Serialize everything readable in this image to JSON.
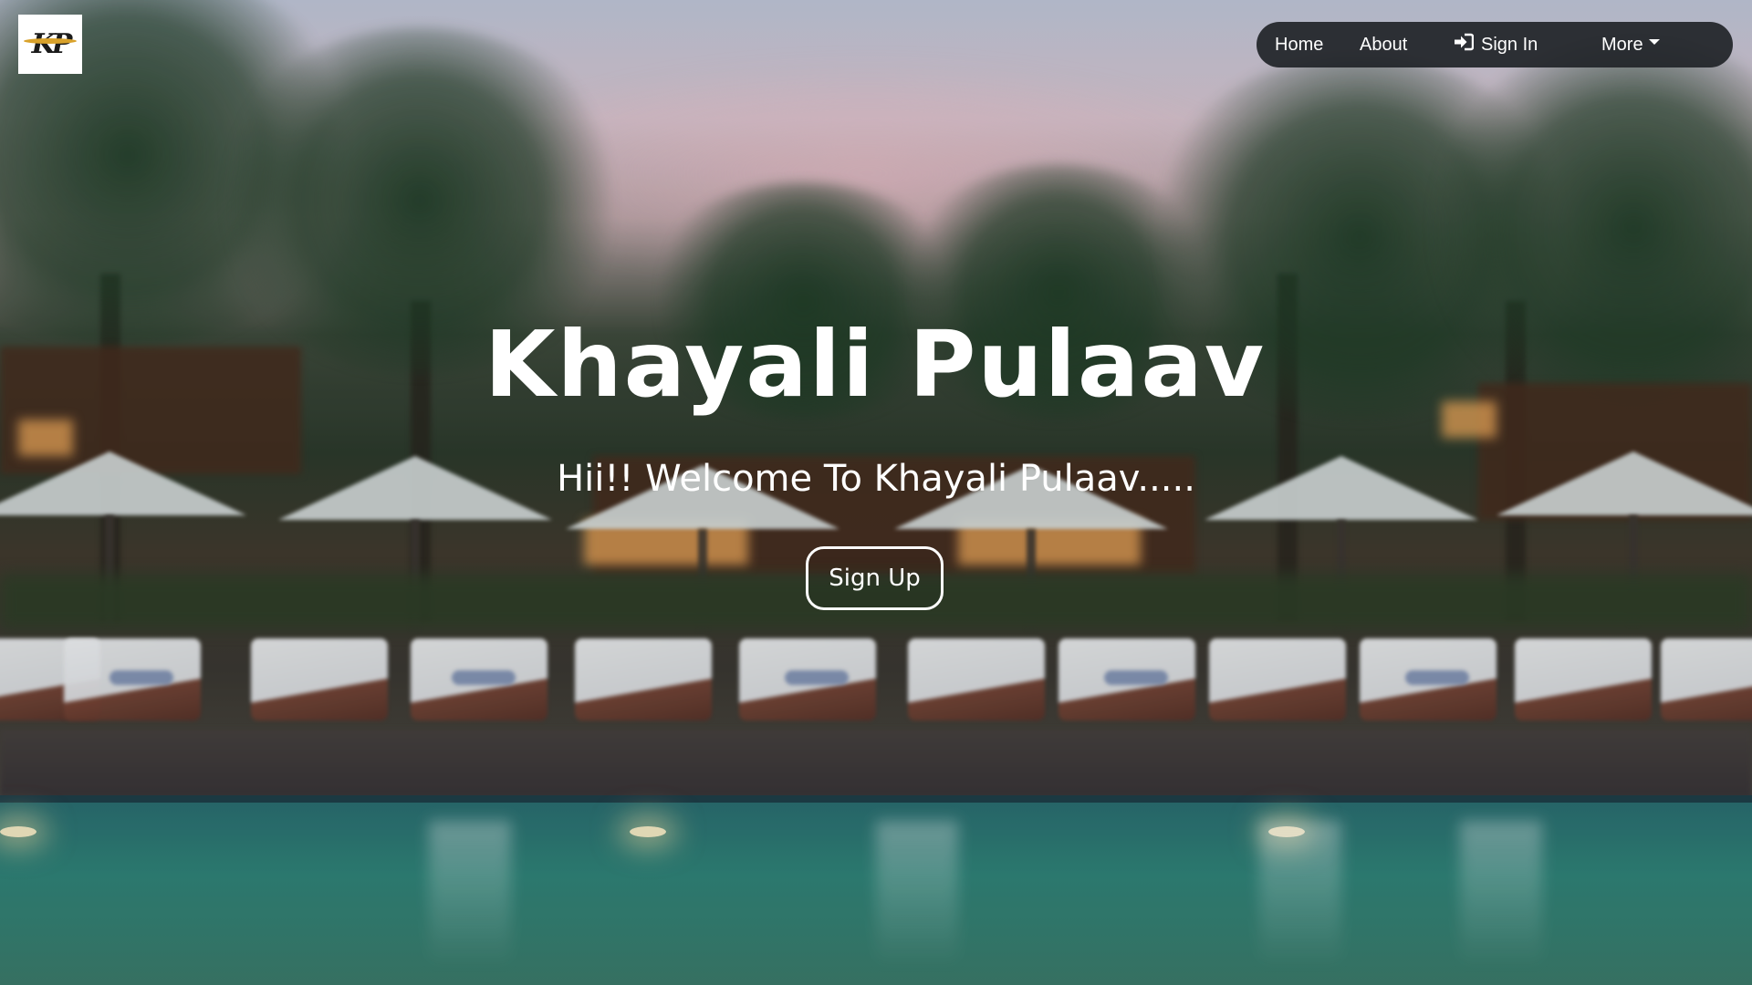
{
  "brand": {
    "logo_text": "KP",
    "logo_icon": "kp-logo-icon"
  },
  "nav": {
    "home": "Home",
    "about": "About",
    "signin": "Sign In",
    "signin_icon": "sign-in-icon",
    "more": "More"
  },
  "hero": {
    "title": "Khayali Pulaav",
    "subtitle": "Hii!! Welcome To Khayali Pulaav.....",
    "signup_label": "Sign Up"
  },
  "colors": {
    "navbar_bg": "#212529",
    "text": "#ffffff",
    "accent_gold": "#d9a22b"
  }
}
